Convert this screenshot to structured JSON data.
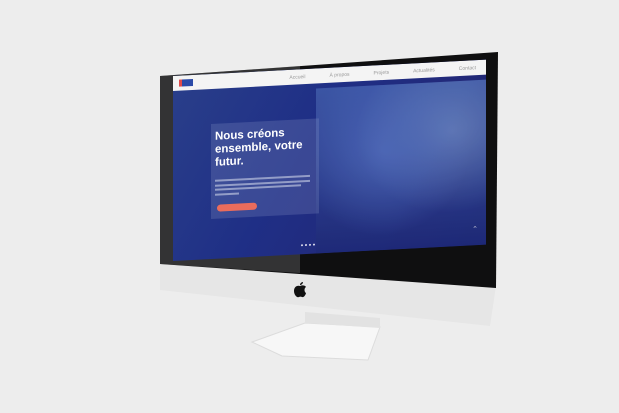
{
  "website": {
    "nav": [
      "Accueil",
      "À propos",
      "Projets",
      "Actualités",
      "Contact"
    ],
    "hero_title": "Nous créons ensemble, votre futur.",
    "slide_count": 4
  },
  "device": {
    "brand_icon": "apple-logo-icon"
  },
  "colors": {
    "background": "#ededed",
    "hero": "#1f2f86",
    "cta": "#ea6c5c",
    "bezel": "#111111"
  }
}
